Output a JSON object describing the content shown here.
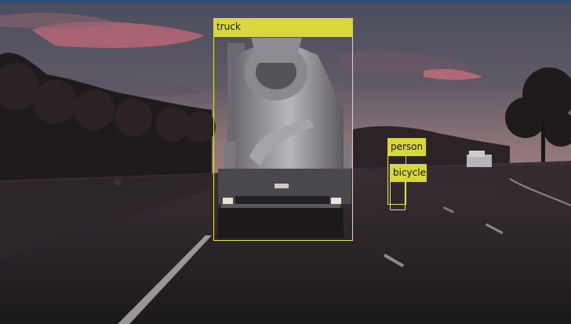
{
  "colors": {
    "box": "#e1e35a",
    "label_bg": "#d8d83c",
    "label_text": "#111111"
  },
  "detections": [
    {
      "label": "truck"
    },
    {
      "label": "person"
    },
    {
      "label": "bicycle"
    }
  ]
}
